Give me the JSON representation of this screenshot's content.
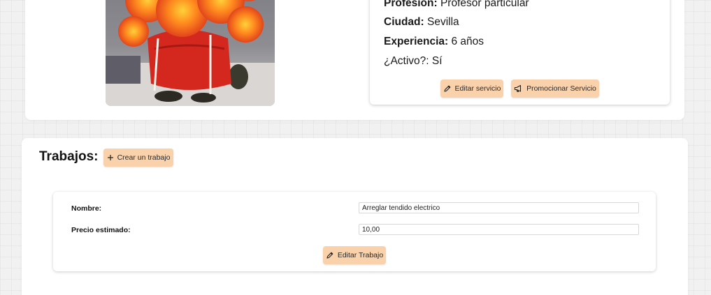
{
  "service": {
    "fields": [
      {
        "label": "Profesión:",
        "value": " Profesor particular"
      },
      {
        "label": "Ciudad:",
        "value": " Sevilla"
      },
      {
        "label": "Experiencia:",
        "value": " 6 años"
      },
      {
        "label": "¿Activo?:",
        "value": " Sí"
      }
    ],
    "edit_label": "Editar servicio",
    "promote_label": "Promocionar Servicio"
  },
  "jobs": {
    "title": "Trabajos:",
    "create_label": "Crear un trabajo",
    "items": [
      {
        "name_label": "Nombre:",
        "name_value": "Arreglar tendido electrico",
        "price_label": "Precio estimado:",
        "price_value": "10,00",
        "edit_label": "Editar Trabajo"
      }
    ]
  },
  "colors": {
    "button_bg": "#f9d1ab",
    "page_bg": "#f1f1f1"
  },
  "icons": [
    "pencil-icon",
    "megaphone-icon",
    "plus-icon"
  ]
}
